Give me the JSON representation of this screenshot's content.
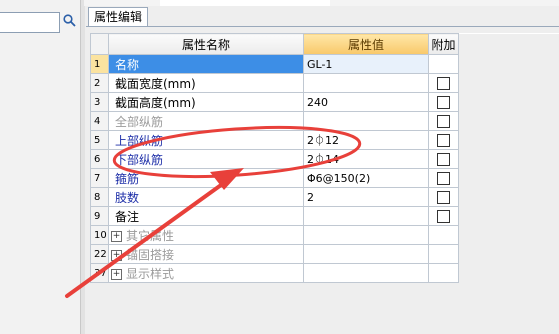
{
  "search": {
    "value": "",
    "icon": "search-icon"
  },
  "tab": {
    "label": "属性编辑"
  },
  "grid": {
    "headers": {
      "num": "",
      "name": "属性名称",
      "value": "属性值",
      "extra": "附加"
    },
    "rows": [
      {
        "num": "1",
        "name": "名称",
        "value": "GL-1",
        "checkbox": false,
        "expand": false
      },
      {
        "num": "2",
        "name": "截面宽度(mm)",
        "value": "",
        "checkbox": true,
        "expand": false
      },
      {
        "num": "3",
        "name": "截面高度(mm)",
        "value": "240",
        "checkbox": true,
        "expand": false
      },
      {
        "num": "4",
        "name": "全部纵筋",
        "value": "",
        "checkbox": true,
        "expand": false
      },
      {
        "num": "5",
        "name": "上部纵筋",
        "value": "2⏀12",
        "checkbox": true,
        "expand": false
      },
      {
        "num": "6",
        "name": "下部纵筋",
        "value": "2⏀14",
        "checkbox": true,
        "expand": false
      },
      {
        "num": "7",
        "name": "箍筋",
        "value": "Φ6@150(2)",
        "checkbox": true,
        "expand": false
      },
      {
        "num": "8",
        "name": "肢数",
        "value": "2",
        "checkbox": true,
        "expand": false
      },
      {
        "num": "9",
        "name": "备注",
        "value": "",
        "checkbox": true,
        "expand": false
      },
      {
        "num": "10",
        "name": "其它属性",
        "value": "",
        "checkbox": false,
        "expand": true
      },
      {
        "num": "22",
        "name": "锚固搭接",
        "value": "",
        "checkbox": false,
        "expand": true
      },
      {
        "num": "37",
        "name": "显示样式",
        "value": "",
        "checkbox": false,
        "expand": true
      }
    ]
  },
  "colors": {
    "selection": "#3d8ee6",
    "header_value": "#f8c86a",
    "annotation": "#e8403a",
    "blue_text": "#1d2ea8",
    "gray_text": "#9b9b9b"
  }
}
